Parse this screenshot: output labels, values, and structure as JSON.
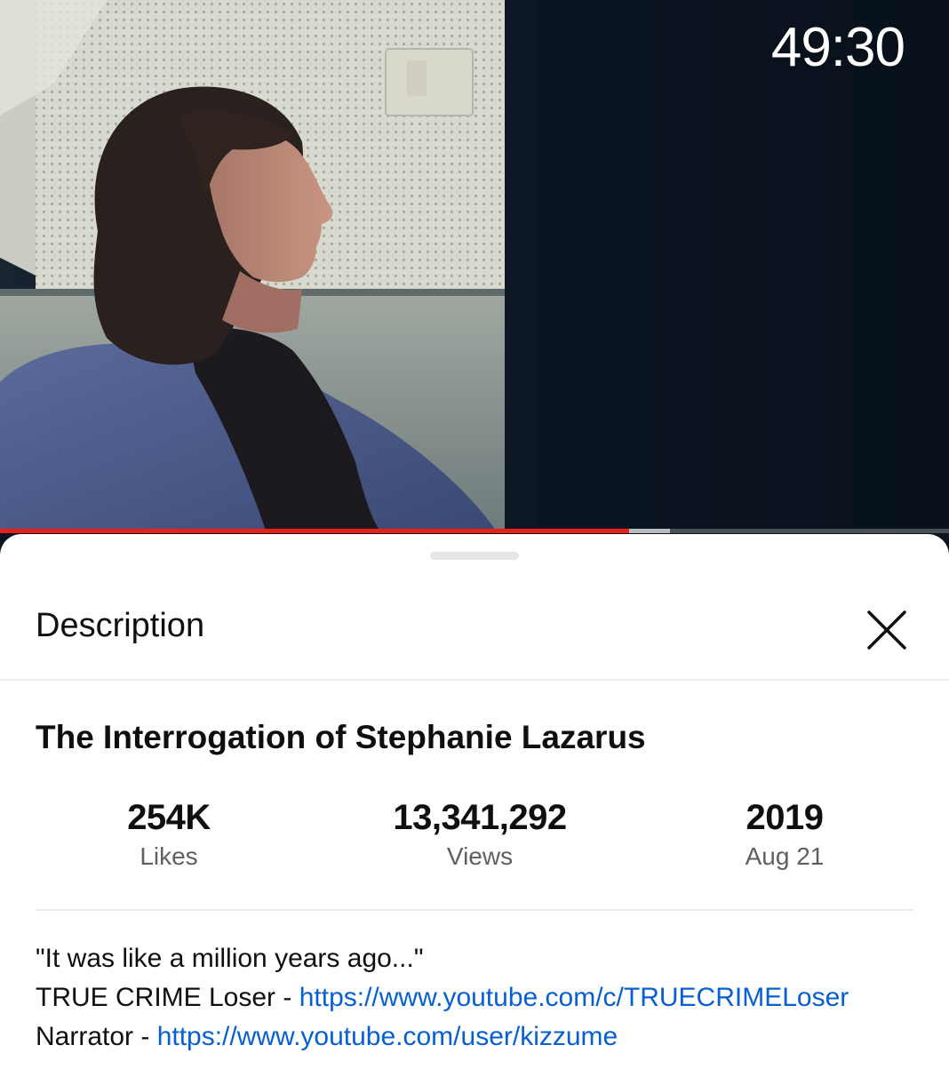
{
  "player": {
    "duration": "49:30",
    "progress_fraction": 0.663,
    "buffered_fraction": 0.706,
    "colors": {
      "played": "#e62117",
      "buffered": "#b8bcc0",
      "track": "#4a4f55"
    }
  },
  "sheet": {
    "header_title": "Description",
    "close_icon": "close-icon"
  },
  "video": {
    "title": "The Interrogation of Stephanie Lazarus",
    "stats": [
      {
        "value": "254K",
        "label": "Likes"
      },
      {
        "value": "13,341,292",
        "label": "Views"
      },
      {
        "value": "2019",
        "label": "Aug 21"
      }
    ]
  },
  "description": {
    "line1": "\"It was like a million years ago...\"",
    "line2_prefix": "TRUE CRIME Loser - ",
    "line2_link": "https://www.youtube.com/c/TRUECRIMELoser",
    "line3_prefix": "Narrator - ",
    "line3_link": "https://www.youtube.com/user/kizzume",
    "link_color": "#065fd4"
  }
}
